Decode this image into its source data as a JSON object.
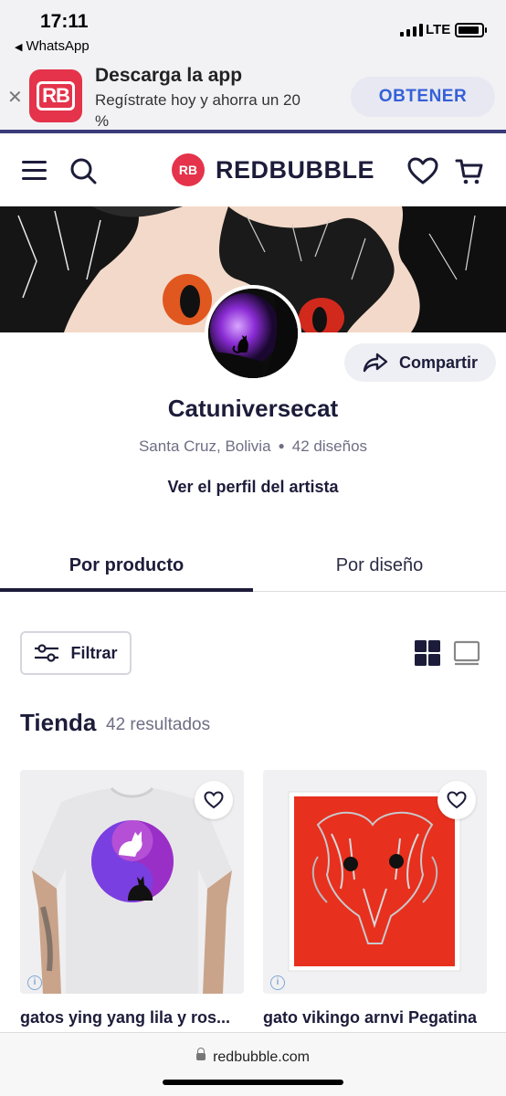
{
  "status_bar": {
    "time": "17:11",
    "back_app": "WhatsApp",
    "network": "LTE"
  },
  "app_banner": {
    "logo_text": "RB",
    "title": "Descarga la app",
    "subtitle": "Regístrate hoy y ahorra un 20 %",
    "button": "OBTENER"
  },
  "header": {
    "brand": "REDBUBBLE",
    "brand_mark": "RB"
  },
  "profile": {
    "name": "Catuniversecat",
    "location": "Santa Cruz, Bolivia",
    "designs": "42 diseños",
    "share_label": "Compartir",
    "profile_link": "Ver el perfil del artista"
  },
  "tabs": {
    "by_product": "Por producto",
    "by_design": "Por diseño"
  },
  "toolbar": {
    "filter_label": "Filtrar"
  },
  "shop": {
    "title": "Tienda",
    "count": "42 resultados"
  },
  "products": [
    {
      "title": "gatos ying yang lila y ros..."
    },
    {
      "title": "gato vikingo arnvi Pegatina"
    }
  ],
  "browser": {
    "url": "redbubble.com"
  },
  "colors": {
    "brand_red": "#e4334a",
    "navy": "#1c1c3a",
    "banner_button_text": "#3560d8"
  }
}
